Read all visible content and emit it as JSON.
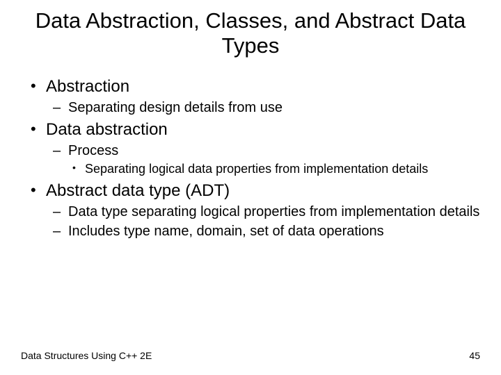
{
  "title": "Data Abstraction, Classes, and Abstract Data Types",
  "bullets": {
    "b1": "Abstraction",
    "b1_1": "Separating design details from use",
    "b2": "Data abstraction",
    "b2_1": "Process",
    "b2_1_1": "Separating logical data properties from implementation details",
    "b3": "Abstract data type (ADT)",
    "b3_1": "Data type separating logical properties from implementation details",
    "b3_2": "Includes type name, domain, set of data operations"
  },
  "footer": {
    "left": "Data Structures Using C++ 2E",
    "right": "45"
  }
}
